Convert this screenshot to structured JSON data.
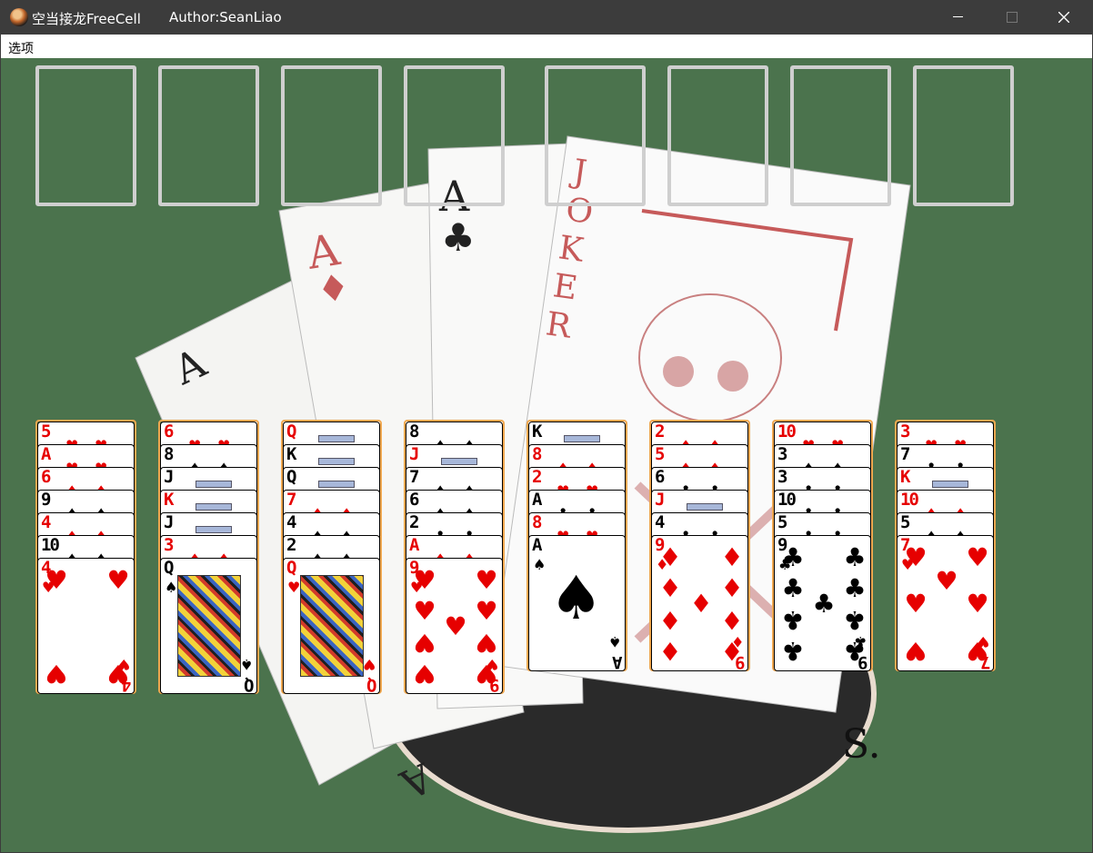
{
  "window": {
    "title": "空当接龙FreeCell",
    "author": "Author:SeanLiao",
    "icon": "app-icon"
  },
  "menu": {
    "options_label": "选项"
  },
  "board": {
    "felt_color": "#4b734d",
    "slot_border_color": "#cfcfcf",
    "cascade_highlight_color": "#f0a850",
    "top_slots": [
      "free-cell",
      "free-cell",
      "free-cell",
      "free-cell",
      "foundation",
      "foundation",
      "foundation",
      "foundation"
    ],
    "cascades": [
      {
        "stacked": [
          {
            "r": "5",
            "s": "♥"
          },
          {
            "r": "A",
            "s": "♥"
          },
          {
            "r": "6",
            "s": "♦"
          },
          {
            "r": "9",
            "s": "♠"
          },
          {
            "r": "4",
            "s": "♦"
          },
          {
            "r": "10",
            "s": "♠"
          }
        ],
        "top": {
          "r": "4",
          "s": "♥"
        }
      },
      {
        "stacked": [
          {
            "r": "6",
            "s": "♥"
          },
          {
            "r": "8",
            "s": "♠"
          },
          {
            "r": "J",
            "s": "♣"
          },
          {
            "r": "K",
            "s": "♦"
          },
          {
            "r": "J",
            "s": "♠"
          },
          {
            "r": "3",
            "s": "♦"
          }
        ],
        "top": {
          "r": "Q",
          "s": "♠"
        }
      },
      {
        "stacked": [
          {
            "r": "Q",
            "s": "♦"
          },
          {
            "r": "K",
            "s": "♣"
          },
          {
            "r": "Q",
            "s": "♣"
          },
          {
            "r": "7",
            "s": "♦"
          },
          {
            "r": "4",
            "s": "♠"
          },
          {
            "r": "2",
            "s": "♠"
          }
        ],
        "top": {
          "r": "Q",
          "s": "♥"
        }
      },
      {
        "stacked": [
          {
            "r": "8",
            "s": "♠"
          },
          {
            "r": "J",
            "s": "♦"
          },
          {
            "r": "7",
            "s": "♠"
          },
          {
            "r": "6",
            "s": "♠"
          },
          {
            "r": "2",
            "s": "♣"
          },
          {
            "r": "A",
            "s": "♦"
          }
        ],
        "top": {
          "r": "9",
          "s": "♥"
        }
      },
      {
        "stacked": [
          {
            "r": "K",
            "s": "♠"
          },
          {
            "r": "8",
            "s": "♦"
          },
          {
            "r": "2",
            "s": "♥"
          },
          {
            "r": "A",
            "s": "♣"
          },
          {
            "r": "8",
            "s": "♥"
          }
        ],
        "top": {
          "r": "A",
          "s": "♠"
        }
      },
      {
        "stacked": [
          {
            "r": "2",
            "s": "♦"
          },
          {
            "r": "5",
            "s": "♦"
          },
          {
            "r": "6",
            "s": "♣"
          },
          {
            "r": "J",
            "s": "♥"
          },
          {
            "r": "4",
            "s": "♣"
          }
        ],
        "top": {
          "r": "9",
          "s": "♦"
        }
      },
      {
        "stacked": [
          {
            "r": "10",
            "s": "♥"
          },
          {
            "r": "3",
            "s": "♠"
          },
          {
            "r": "3",
            "s": "♣"
          },
          {
            "r": "10",
            "s": "♣"
          },
          {
            "r": "5",
            "s": "♣"
          }
        ],
        "top": {
          "r": "9",
          "s": "♣"
        }
      },
      {
        "stacked": [
          {
            "r": "3",
            "s": "♥"
          },
          {
            "r": "7",
            "s": "♣"
          },
          {
            "r": "K",
            "s": "♥"
          },
          {
            "r": "10",
            "s": "♦"
          },
          {
            "r": "5",
            "s": "♠"
          }
        ],
        "top": {
          "r": "7",
          "s": "♥"
        }
      }
    ]
  }
}
